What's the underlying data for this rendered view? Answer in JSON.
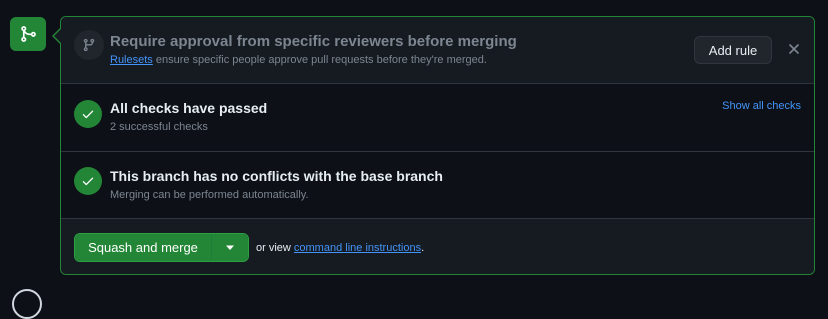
{
  "merge_badge": {
    "icon": "git-merge-icon",
    "color": "#238636"
  },
  "rule_section": {
    "icon": "git-branch-icon",
    "title": "Require approval from specific reviewers before merging",
    "link_text": "Rulesets",
    "description_rest": " ensure specific people approve pull requests before they're merged.",
    "add_rule_label": "Add rule",
    "close_icon": "close-icon"
  },
  "checks_section": {
    "icon": "check-icon",
    "title": "All checks have passed",
    "subtitle": "2 successful checks",
    "show_all_label": "Show all checks"
  },
  "conflicts_section": {
    "icon": "check-icon",
    "title": "This branch has no conflicts with the base branch",
    "subtitle": "Merging can be performed automatically."
  },
  "merge_section": {
    "merge_button_label": "Squash and merge",
    "dropdown_icon": "triangle-down-icon",
    "or_view_text": "or view ",
    "cli_link_text": "command line instructions",
    "trailing_period": "."
  },
  "colors": {
    "accent_green": "#238636",
    "link_blue": "#4493f8",
    "background": "#0d1117",
    "panel_header": "#161b22"
  }
}
